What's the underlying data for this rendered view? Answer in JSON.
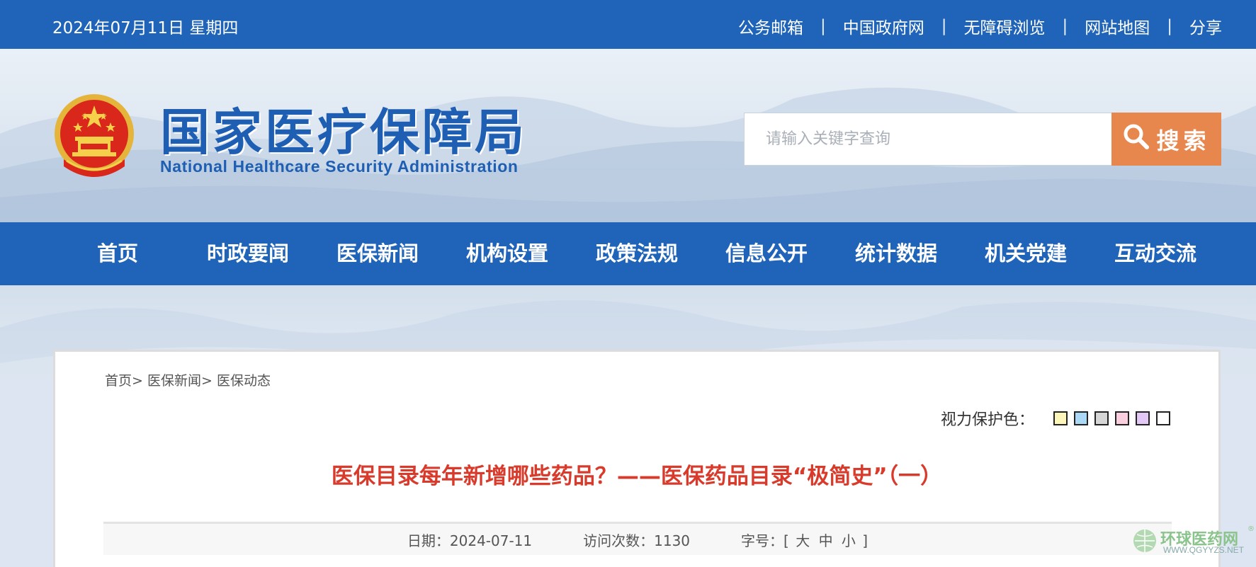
{
  "topbar": {
    "date": "2024年07月11日 星期四",
    "links": [
      {
        "label": "公务邮箱"
      },
      {
        "label": "中国政府网"
      },
      {
        "label": "无障碍浏览"
      },
      {
        "label": "网站地图"
      },
      {
        "label": "分享"
      }
    ],
    "separator": "|"
  },
  "header": {
    "title": "国家医疗保障局",
    "subtitle": "National Healthcare Security Administration",
    "search_placeholder": "请输入关键字查询",
    "search_button": "搜索",
    "emblem_icon": "national-emblem-icon"
  },
  "nav": {
    "items": [
      {
        "label": "首页"
      },
      {
        "label": "时政要闻"
      },
      {
        "label": "医保新闻"
      },
      {
        "label": "机构设置"
      },
      {
        "label": "政策法规"
      },
      {
        "label": "信息公开"
      },
      {
        "label": "统计数据"
      },
      {
        "label": "机关党建"
      },
      {
        "label": "互动交流"
      }
    ]
  },
  "breadcrumb": {
    "items": [
      {
        "label": "首页"
      },
      {
        "label": "医保新闻"
      },
      {
        "label": "医保动态"
      }
    ],
    "separator": ">"
  },
  "eyecare": {
    "label": "视力保护色：",
    "swatches": [
      "#fdf6b9",
      "#aad8f5",
      "#d6d6d6",
      "#f9cfe0",
      "#e3c7f7",
      "#ffffff"
    ]
  },
  "article": {
    "title": "医保目录每年新增哪些药品？——医保药品目录“极简史”（一）",
    "date_label": "日期：",
    "date": "2024-07-11",
    "views_label": "访问次数：",
    "views": "1130",
    "font_size_label": "字号：",
    "font_size_open": "[",
    "font_sizes": [
      "大",
      "中",
      "小"
    ],
    "font_size_close": "]"
  },
  "watermark": {
    "brand": "环球医药网",
    "reg_mark": "®",
    "url": "WWW.QGYYZS.NET"
  },
  "colors": {
    "primary_blue": "#1f64b8",
    "search_orange": "#e8874d",
    "title_red": "#d83a2b"
  }
}
